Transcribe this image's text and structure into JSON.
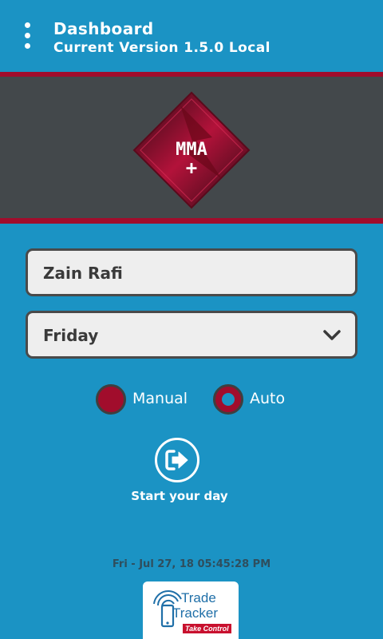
{
  "header": {
    "title": "Dashboard",
    "subtitle": "Current Version 1.5.0 Local",
    "menu_icon": "overflow-menu-icon"
  },
  "banner": {
    "logo_text": "MMA",
    "logo_plus": "+"
  },
  "form": {
    "name_value": "Zain Rafi",
    "day_value": "Friday",
    "day_dropdown_icon": "chevron-down-icon"
  },
  "mode": {
    "options": [
      {
        "label": "Manual",
        "selected": false
      },
      {
        "label": "Auto",
        "selected": true
      }
    ]
  },
  "start": {
    "label": "Start your day",
    "icon": "sign-in-icon"
  },
  "footer": {
    "timestamp": "Fri - Jul 27, 18 05:45:28 PM",
    "brand_line1": "Trade",
    "brand_line2": "Tracker",
    "brand_tagline": "Take Control"
  },
  "colors": {
    "background": "#1b93c4",
    "accent": "#a10d2c",
    "banner": "#43484b"
  }
}
